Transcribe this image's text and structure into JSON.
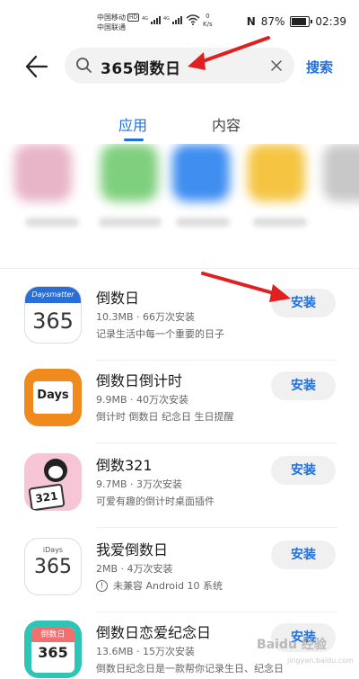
{
  "status_bar": {
    "carrier_1": "中国移动",
    "carrier_1_badge": "HD",
    "carrier_2": "中国联通",
    "net_speed_value": "0",
    "net_speed_unit": "K/s",
    "battery_percent": "87%",
    "battery_level": 0.87,
    "time": "02:39"
  },
  "header": {
    "search_query": "365倒数日",
    "search_button_label": "搜索"
  },
  "tabs": [
    {
      "label": "应用",
      "active": true
    },
    {
      "label": "内容",
      "active": false
    }
  ],
  "apps": [
    {
      "name": "倒数日",
      "meta": "10.3MB · 66万次安装",
      "description": "记录生活中每一个重要的日子",
      "install_label": "安装",
      "icon_brand": "Daysmatter",
      "icon_number": "365"
    },
    {
      "name": "倒数日倒计时",
      "meta": "9.9MB · 40万次安装",
      "description": "倒计时 倒数日 纪念日 生日提醒",
      "install_label": "安装",
      "icon_text": "Days"
    },
    {
      "name": "倒数321",
      "meta": "9.7MB · 3万次安装",
      "description": "可爱有趣的倒计时桌面插件",
      "install_label": "安装",
      "icon_number": "321"
    },
    {
      "name": "我爱倒数日",
      "meta": "2MB · 4万次安装",
      "description": "未兼容 Android 10 系统",
      "install_label": "安装",
      "icon_brand": "iDays",
      "icon_number": "365"
    },
    {
      "name": "倒数日恋爱纪念日",
      "meta": "13.6MB · 15万次安装",
      "description": "倒数日纪念日是一款帮你记录生日、纪念日",
      "install_label": "安装",
      "icon_text": "倒数日",
      "icon_number": "365"
    }
  ],
  "watermark": {
    "text": "Baidu 经验",
    "sub": "jingyan.baidu.com"
  },
  "colors": {
    "accent": "#1f6fe0",
    "annotation_arrow": "#e02020"
  }
}
